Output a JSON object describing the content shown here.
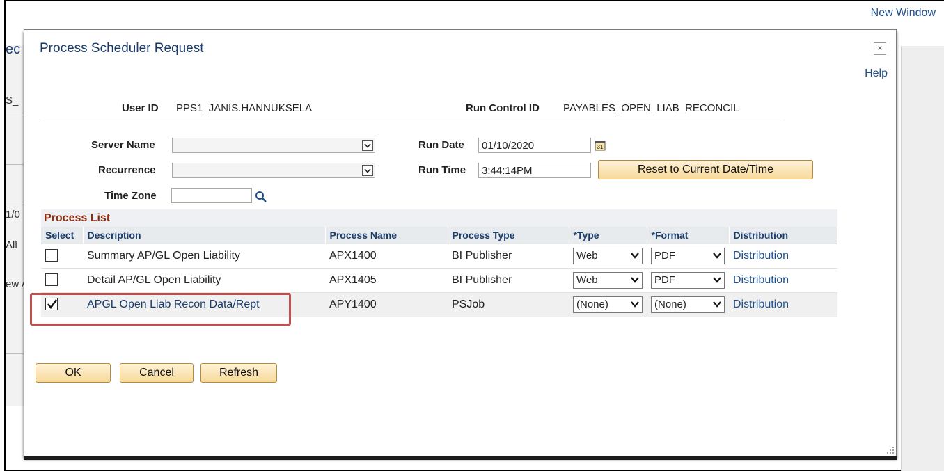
{
  "browser": {
    "new_window_label": "New Window"
  },
  "background": {
    "fragments": [
      "ec",
      "S_",
      "1/0",
      "All",
      "ew A"
    ]
  },
  "modal": {
    "title": "Process Scheduler Request",
    "close_label": "×",
    "help_label": "Help"
  },
  "header": {
    "user_id_label": "User ID",
    "user_id_value": "PPS1_JANIS.HANNUKSELA",
    "run_control_label": "Run Control ID",
    "run_control_value": "PAYABLES_OPEN_LIAB_RECONCIL"
  },
  "form": {
    "server_name_label": "Server Name",
    "server_name_value": "",
    "recurrence_label": "Recurrence",
    "recurrence_value": "",
    "time_zone_label": "Time Zone",
    "time_zone_value": "",
    "run_date_label": "Run Date",
    "run_date_value": "01/10/2020",
    "run_time_label": "Run Time",
    "run_time_value": "3:44:14PM",
    "reset_button_label": "Reset to Current Date/Time"
  },
  "process_list": {
    "title": "Process List",
    "columns": [
      "Select",
      "Description",
      "Process Name",
      "Process Type",
      "*Type",
      "*Format",
      "Distribution"
    ],
    "rows": [
      {
        "checked": false,
        "description": "Summary AP/GL Open Liability",
        "process_name": "APX1400",
        "process_type": "BI Publisher",
        "type": "Web",
        "format": "PDF",
        "distribution": "Distribution"
      },
      {
        "checked": false,
        "description": "Detail AP/GL Open Liability",
        "process_name": "APX1405",
        "process_type": "BI Publisher",
        "type": "Web",
        "format": "PDF",
        "distribution": "Distribution"
      },
      {
        "checked": true,
        "description": "APGL Open Liab Recon Data/Rept",
        "process_name": "APY1400",
        "process_type": "PSJob",
        "type": "(None)",
        "format": "(None)",
        "distribution": "Distribution"
      }
    ]
  },
  "buttons": {
    "ok": "OK",
    "cancel": "Cancel",
    "refresh": "Refresh"
  },
  "colors": {
    "link": "#1d4f8c",
    "highlight": "#c0504d",
    "section_title": "#8b2d0e",
    "button_fill": "#f7d99a"
  },
  "icons": {
    "calendar": "calendar-icon",
    "lookup": "magnifier-icon",
    "close": "close-icon"
  }
}
